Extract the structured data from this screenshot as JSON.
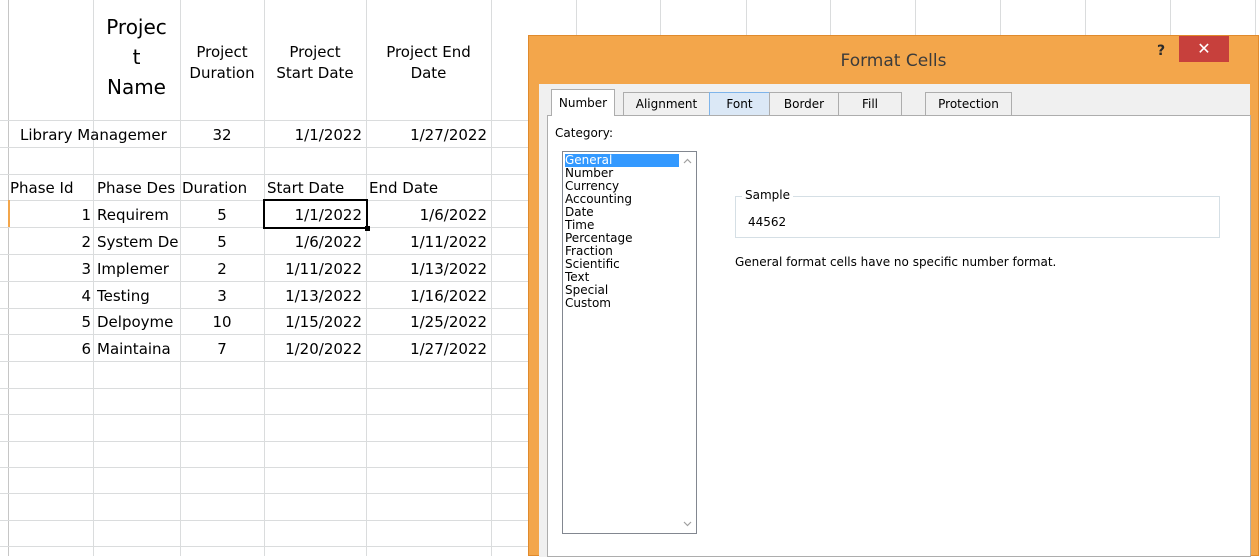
{
  "sheet": {
    "header": {
      "project_name": "Projec\nt\nName",
      "project_duration": "Project Duration",
      "project_start": "Project Start Date",
      "project_end": "Project End Date"
    },
    "project": {
      "name": "Library Managemer",
      "duration": "32",
      "start": "1/1/2022",
      "end": "1/27/2022"
    },
    "phase_header": {
      "id": "Phase Id",
      "desc": "Phase Des",
      "duration": "Duration",
      "start": "Start Date",
      "end": "End Date"
    },
    "phases": [
      {
        "id": "1",
        "desc": "Requirem",
        "duration": "5",
        "start": "1/1/2022",
        "end": "1/6/2022"
      },
      {
        "id": "2",
        "desc": "System De",
        "duration": "5",
        "start": "1/6/2022",
        "end": "1/11/2022"
      },
      {
        "id": "3",
        "desc": "Implemer",
        "duration": "2",
        "start": "1/11/2022",
        "end": "1/13/2022"
      },
      {
        "id": "4",
        "desc": "Testing",
        "duration": "3",
        "start": "1/13/2022",
        "end": "1/16/2022"
      },
      {
        "id": "5",
        "desc": "Delpoyme",
        "duration": "10",
        "start": "1/15/2022",
        "end": "1/25/2022"
      },
      {
        "id": "6",
        "desc": "Maintaina",
        "duration": "7",
        "start": "1/20/2022",
        "end": "1/27/2022"
      }
    ],
    "edge_text": "1"
  },
  "dialog": {
    "title": "Format Cells",
    "help_label": "?",
    "close_label": "✕",
    "tabs": [
      "Number",
      "Alignment",
      "Font",
      "Border",
      "Fill",
      "Protection"
    ],
    "active_tab": "Number",
    "category_label": "Category:",
    "categories": [
      "General",
      "Number",
      "Currency",
      "Accounting",
      "Date",
      "Time",
      "Percentage",
      "Fraction",
      "Scientific",
      "Text",
      "Special",
      "Custom"
    ],
    "selected_category": "General",
    "sample_label": "Sample",
    "sample_value": "44562",
    "description": "General format cells have no specific number format.",
    "colors": {
      "title_bar": "#f3a64b",
      "close": "#c7403c",
      "selection": "#3399ff"
    },
    "icons": {
      "scroll_up": "chevron-up-icon",
      "scroll_down": "chevron-down-icon"
    }
  }
}
